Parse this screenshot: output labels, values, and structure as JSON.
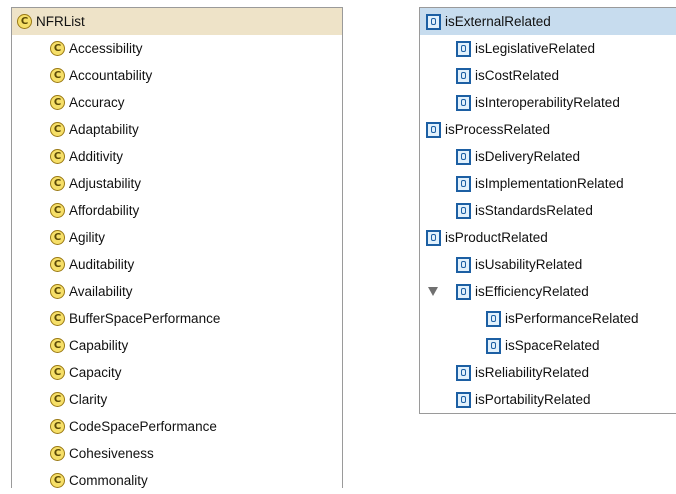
{
  "class_tree": {
    "root": "NFRList",
    "items": [
      "Accessibility",
      "Accountability",
      "Accuracy",
      "Adaptability",
      "Additivity",
      "Adjustability",
      "Affordability",
      "Agility",
      "Auditability",
      "Availability",
      "BufferSpacePerformance",
      "Capability",
      "Capacity",
      "Clarity",
      "CodeSpacePerformance",
      "Cohesiveness",
      "Commonality"
    ],
    "icon_letter": "C",
    "selected": "NFRList"
  },
  "property_tree": {
    "items": [
      {
        "label": "isExternalRelated",
        "level": 0,
        "selected": true
      },
      {
        "label": "isLegislativeRelated",
        "level": 1
      },
      {
        "label": "isCostRelated",
        "level": 1
      },
      {
        "label": "isInteroperabilityRelated",
        "level": 1
      },
      {
        "label": "isProcessRelated",
        "level": 0
      },
      {
        "label": "isDeliveryRelated",
        "level": 1
      },
      {
        "label": "isImplementationRelated",
        "level": 1
      },
      {
        "label": "isStandardsRelated",
        "level": 1
      },
      {
        "label": "isProductRelated",
        "level": 0
      },
      {
        "label": "isUsabilityRelated",
        "level": 1
      },
      {
        "label": "isEfficiencyRelated",
        "level": 1,
        "expanded": true
      },
      {
        "label": "isPerformanceRelated",
        "level": 2
      },
      {
        "label": "isSpaceRelated",
        "level": 2
      },
      {
        "label": "isReliabilityRelated",
        "level": 1
      },
      {
        "label": "isPortabilityRelated",
        "level": 1
      }
    ]
  },
  "colors": {
    "class_icon": "#f6df68",
    "property_icon_border": "#1c5fa3",
    "class_selection": "#eee3c8",
    "property_selection": "#c7dcee"
  }
}
